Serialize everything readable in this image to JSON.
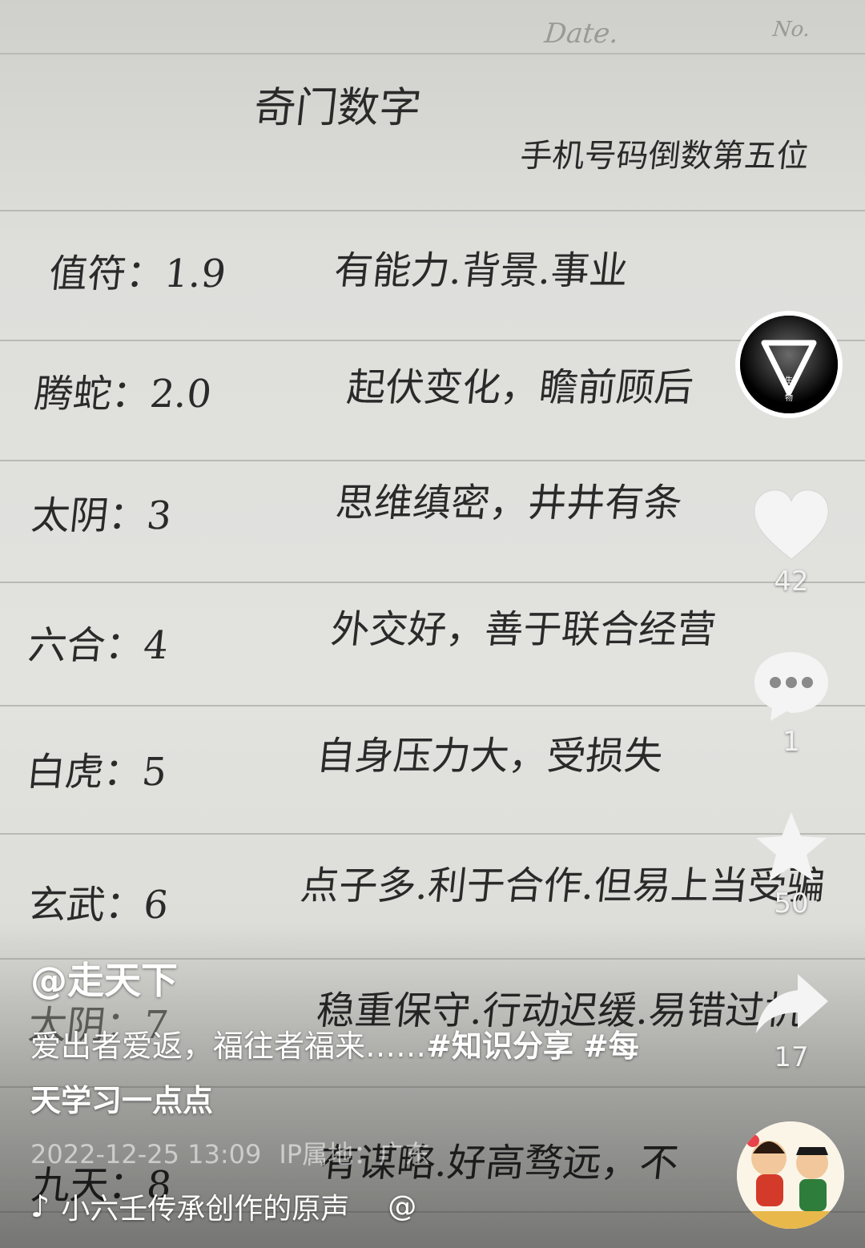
{
  "notebook": {
    "header": {
      "date_label": "Date.",
      "no_label": "No."
    },
    "title": "奇门数字",
    "subtitle": "手机号码倒数第五位",
    "lines": [
      {
        "name": "值符：1.9",
        "meaning": "有能力.背景.事业"
      },
      {
        "name": "腾蛇：2.0",
        "meaning": "起伏变化，瞻前顾后"
      },
      {
        "name": "太阴：3",
        "meaning": "思维缜密，井井有条"
      },
      {
        "name": "六合：4",
        "meaning": "外交好，善于联合经营"
      },
      {
        "name": "白虎：5",
        "meaning": "自身压力大，受损失"
      },
      {
        "name": "玄武：6",
        "meaning": "点子多.利于合作.但易上当受骗"
      },
      {
        "name": "太阴：7",
        "meaning": "稳重保守.行动迟缓.易错过机"
      },
      {
        "name": "九天：8",
        "meaning": "有谋略.好高骛远，不"
      }
    ]
  },
  "post": {
    "author": "@走天下",
    "caption_text": "爱出者爱返，福往者福来……",
    "hashtag1": "#知识分享",
    "hashtag2": "#每天学习一点点",
    "date": "2022-12-25 13:09",
    "ip": "IP属地：广东",
    "music": "小六壬传承创作的原声",
    "music_at": "@"
  },
  "actions": {
    "avatar_text": "生万物",
    "likes": "42",
    "comments": "1",
    "favorites": "50",
    "shares": "17"
  },
  "colors": {
    "like": "#ffffff",
    "overlay_text": "#ffffff"
  }
}
